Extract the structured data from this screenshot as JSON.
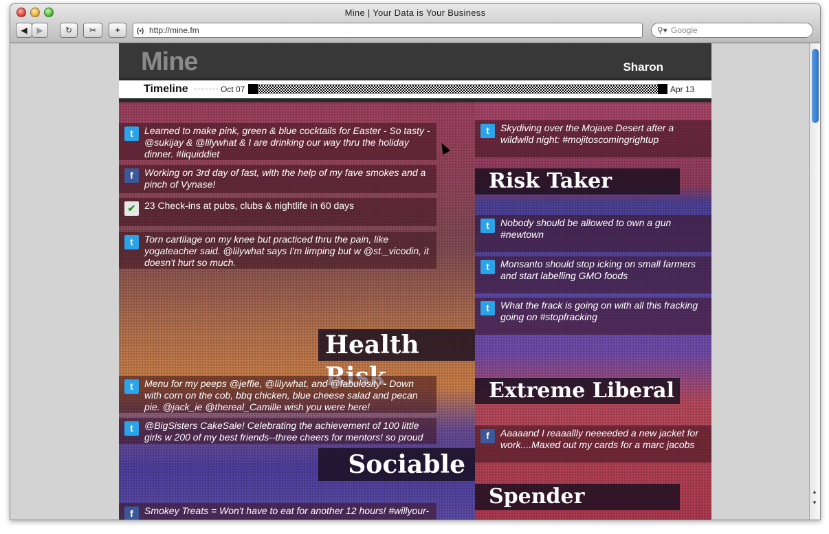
{
  "browser": {
    "window_title": "Mine | Your Data is Your Business",
    "back_label": "◀",
    "forward_label": "▶",
    "reload_label": "↻",
    "bookmark_label": "✂",
    "add_label": "+",
    "address": "http://mine.fm",
    "rss_label": "(•)",
    "search_placeholder": "Google",
    "search_icon": "search-icon"
  },
  "site": {
    "logo": "Mine",
    "user_name": "Sharon"
  },
  "timeline": {
    "label": "Timeline",
    "start_date": "Oct 07",
    "end_date": "Apr 13"
  },
  "left_posts": [
    {
      "source": "twitter",
      "icon": "t",
      "text": "Learned to make pink, green & blue cocktails for Easter - So tasty - @sukijay & @lilywhat & I are drinking our way thru the holiday dinner. #liquiddiet"
    },
    {
      "source": "facebook",
      "icon": "f",
      "text": "Working on 3rd day of fast, with the help of my fave smokes and a pinch of Vynase!"
    },
    {
      "source": "checkin",
      "icon": "✔",
      "text": "23 Check-ins at pubs, clubs & nightlife in 60 days"
    },
    {
      "source": "twitter",
      "icon": "t",
      "text": "Torn cartilage on my knee but practiced thru the pain, like yogateacher said.  @lilywhat says I'm limping but w @st._vicodin, it doesn't hurt so much."
    },
    {
      "source": "twitter",
      "icon": "t",
      "text": "Menu for my peeps @jeffie, @lilywhat, and @fabulosity - Down with corn on the cob, bbq chicken, blue cheese salad and pecan pie. @jack_ie @thereal_Camille wish you were here!"
    },
    {
      "source": "twitter",
      "icon": "t",
      "text": "@BigSisters CakeSale! Celebrating the achievement of 100 little girls w 200 of my best friends--three cheers for mentors!  so proud"
    },
    {
      "source": "facebook",
      "icon": "f",
      "text": "Smokey Treats = Won't have to eat for another 12 hours! #willyour-"
    }
  ],
  "right_posts": [
    {
      "source": "twitter",
      "icon": "t",
      "text": "Skydiving over the Mojave Desert after a wildwild night:  #mojitoscomingrightup"
    },
    {
      "source": "twitter",
      "icon": "t",
      "text": "Nobody should be allowed to own a gun #newtown"
    },
    {
      "source": "twitter",
      "icon": "t",
      "text": "Monsanto should stop icking on small farmers and start labelling GMO foods"
    },
    {
      "source": "twitter",
      "icon": "t",
      "text": "What the frack is going on with all this fracking going on #stopfracking"
    },
    {
      "source": "facebook",
      "icon": "f",
      "text": "Aaaaand I reaaallly neeeeded a new jacket for work....Maxed out my cards for a marc jacobs"
    }
  ],
  "tags": {
    "health_risk": "Health Risk",
    "sociable": "Sociable",
    "risk_taker": "Risk Taker",
    "extreme_liberal": "Extreme Liberal",
    "spender": "Spender"
  },
  "scroll": {
    "up": "▲",
    "down": "▼"
  }
}
